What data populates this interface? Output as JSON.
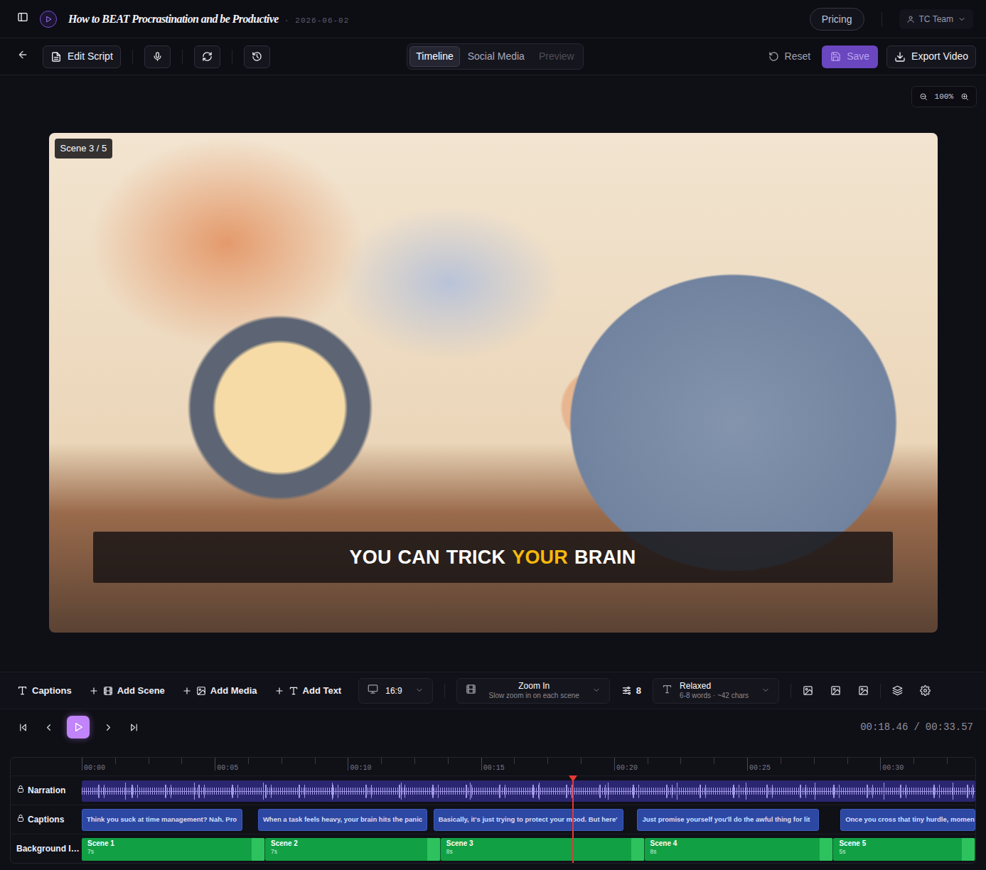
{
  "app": {
    "title": "How to BEAT Procrastination and be Productive",
    "separator": "·",
    "date": "2026-06-02"
  },
  "header": {
    "pricing": "Pricing",
    "account": "TC Team"
  },
  "toolbar": {
    "edit_script": "Edit Script",
    "view_tabs": [
      {
        "label": "Timeline",
        "selected": true,
        "disabled": false
      },
      {
        "label": "Social Media",
        "selected": false,
        "disabled": false
      },
      {
        "label": "Preview",
        "selected": false,
        "disabled": true
      }
    ],
    "reset": "Reset",
    "save": {
      "label": "Save",
      "disabled": true
    },
    "export": "Export Video"
  },
  "zoom": {
    "value": "100%"
  },
  "preview": {
    "scene_badge": "Scene 3 / 5",
    "caption": [
      {
        "text": "YOU",
        "highlight": false
      },
      {
        "text": "CAN",
        "highlight": false
      },
      {
        "text": "TRICK",
        "highlight": false
      },
      {
        "text": "YOUR",
        "highlight": true
      },
      {
        "text": "BRAIN",
        "highlight": false
      }
    ]
  },
  "edit_bar": {
    "captions": "Captions",
    "add_scene": "Add Scene",
    "add_media": "Add Media",
    "add_text": "Add Text",
    "aspect_ratio": "16:9",
    "motion": {
      "title": "Zoom In",
      "subtitle": "Slow zoom in on each scene"
    },
    "scene_count": "8",
    "caption_style": {
      "title": "Relaxed",
      "subtitle": "6-8 words · ~42 chars"
    }
  },
  "playback": {
    "playing": false,
    "current": "00:18.46",
    "separator": "/",
    "total": "00:33.57"
  },
  "timeline": {
    "duration": 33.57,
    "playhead": 18.46,
    "minor_tick": 1.25,
    "ruler": [
      {
        "label": "00:00",
        "seconds": 0
      },
      {
        "label": "00:05",
        "seconds": 5
      },
      {
        "label": "00:10",
        "seconds": 10
      },
      {
        "label": "00:15",
        "seconds": 15
      },
      {
        "label": "00:20",
        "seconds": 20
      },
      {
        "label": "00:25",
        "seconds": 25
      },
      {
        "label": "00:30",
        "seconds": 30
      }
    ],
    "tracks": [
      {
        "label": "Narration",
        "locked": true
      },
      {
        "label": "Captions",
        "locked": true
      },
      {
        "label": "Background I…",
        "locked": false
      }
    ],
    "captions": [
      {
        "text": "Think you suck at time management? Nah. Pro",
        "start": 0,
        "end": 6.03
      },
      {
        "text": "When a task feels heavy, your brain hits the panic",
        "start": 6.62,
        "end": 12.97
      },
      {
        "text": "Basically, it's just trying to protect your mood. But here'",
        "start": 13.21,
        "end": 20.36
      },
      {
        "text": "Just promise yourself you'll do the awful thing for lit",
        "start": 20.87,
        "end": 27.7
      },
      {
        "text": "Once you cross that tiny hurdle, momen",
        "start": 28.5,
        "end": 33.57
      }
    ],
    "scenes": [
      {
        "label": "Scene 1",
        "duration": "7s",
        "start": 0,
        "end": 6.89
      },
      {
        "label": "Scene 2",
        "duration": "7s",
        "start": 6.89,
        "end": 13.48
      },
      {
        "label": "Scene 3",
        "duration": "8s",
        "start": 13.48,
        "end": 21.14
      },
      {
        "label": "Scene 4",
        "duration": "8s",
        "start": 21.14,
        "end": 28.24
      },
      {
        "label": "Scene 5",
        "duration": "5s",
        "start": 28.24,
        "end": 33.57
      }
    ]
  }
}
